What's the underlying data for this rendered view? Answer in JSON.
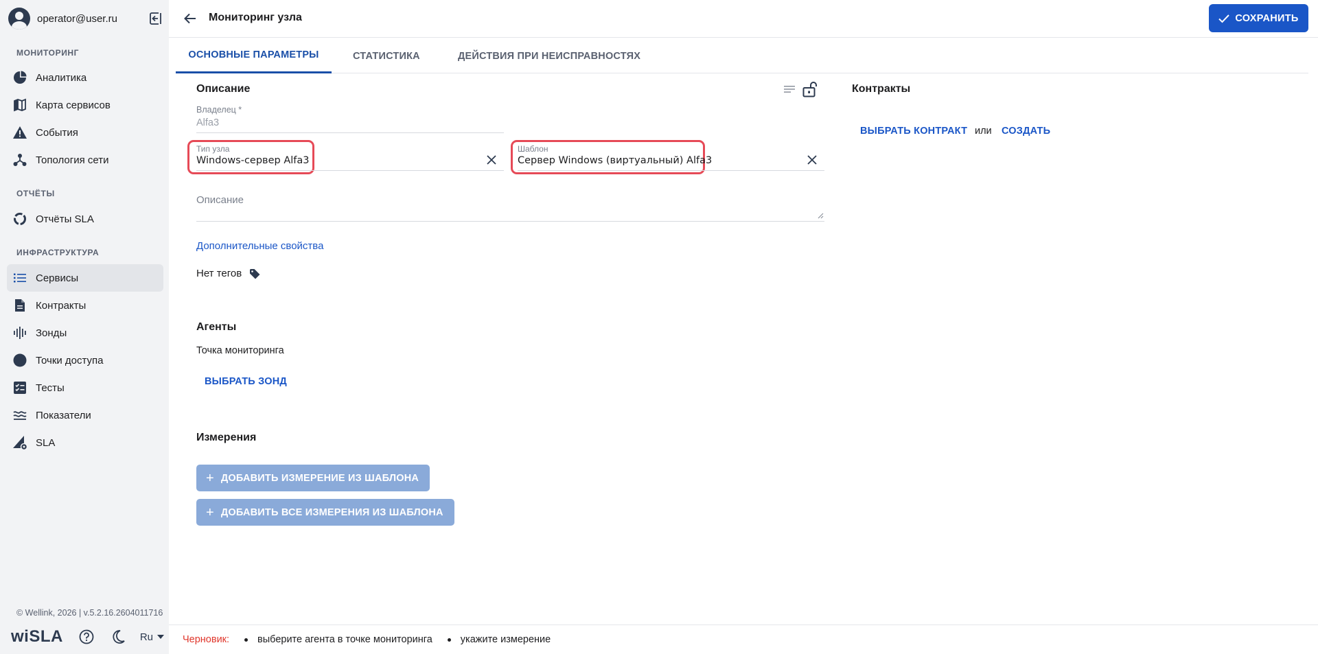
{
  "user": {
    "email": "operator@user.ru"
  },
  "sidebar": {
    "sections": [
      {
        "title": "МОНИТОРИНГ"
      },
      {
        "title": "ОТЧЁТЫ"
      },
      {
        "title": "ИНФРАСТРУКТУРА"
      }
    ],
    "items": [
      {
        "label": "Аналитика",
        "icon": "pie-chart-icon"
      },
      {
        "label": "Карта сервисов",
        "icon": "map-icon"
      },
      {
        "label": "События",
        "icon": "warning-icon"
      },
      {
        "label": "Топология сети",
        "icon": "topology-icon"
      },
      {
        "label": "Отчёты SLA",
        "icon": "circle-report-icon"
      },
      {
        "label": "Сервисы",
        "icon": "list-icon",
        "active": true
      },
      {
        "label": "Контракты",
        "icon": "document-icon"
      },
      {
        "label": "Зонды",
        "icon": "signal-icon"
      },
      {
        "label": "Точки доступа",
        "icon": "dot-icon"
      },
      {
        "label": "Тесты",
        "icon": "checklist-icon"
      },
      {
        "label": "Показатели",
        "icon": "waves-icon"
      },
      {
        "label": "SLA",
        "icon": "sla-icon"
      }
    ],
    "copyright": "© Wellink, 2026 | v.5.2.16.2604011716",
    "logo": "wiSLA",
    "language": "Ru"
  },
  "header": {
    "title": "Мониторинг узла",
    "save_label": "СОХРАНИТЬ"
  },
  "tabs": [
    {
      "label": "ОСНОВНЫЕ ПАРАМЕТРЫ",
      "active": true
    },
    {
      "label": "СТАТИСТИКА"
    },
    {
      "label": "ДЕЙСТВИЯ ПРИ НЕИСПРАВНОСТЯХ"
    }
  ],
  "description_section": {
    "title": "Описание",
    "owner_label": "Владелец *",
    "owner_value": "Alfa3",
    "node_type_label": "Тип узла",
    "node_type_value": "Windows-сервер Alfa3",
    "template_label": "Шаблон",
    "template_value": "Сервер Windows (виртуальный) Alfa3",
    "description_placeholder": "Описание",
    "extra_properties_link": "Дополнительные свойства",
    "no_tags": "Нет тегов"
  },
  "contracts_section": {
    "title": "Контракты",
    "choose_label": "ВЫБРАТЬ КОНТРАКТ",
    "or_label": "или",
    "create_label": "СОЗДАТЬ"
  },
  "agents_section": {
    "title": "Агенты",
    "monitoring_point": "Точка мониторинга",
    "choose_probe": "ВЫБРАТЬ ЗОНД"
  },
  "measurements_section": {
    "title": "Измерения",
    "add_from_template": "ДОБАВИТЬ ИЗМЕРЕНИЕ ИЗ ШАБЛОНА",
    "add_all_from_template": "ДОБАВИТЬ ВСЕ ИЗМЕРЕНИЯ ИЗ ШАБЛОНА"
  },
  "footer": {
    "draft_label": "Черновик:",
    "hints": [
      "выберите агента в точке мониторинга",
      "укажите измерение"
    ]
  },
  "colors": {
    "accent": "#1a56c7",
    "highlight": "#e64a57",
    "draft": "#e0362b"
  }
}
